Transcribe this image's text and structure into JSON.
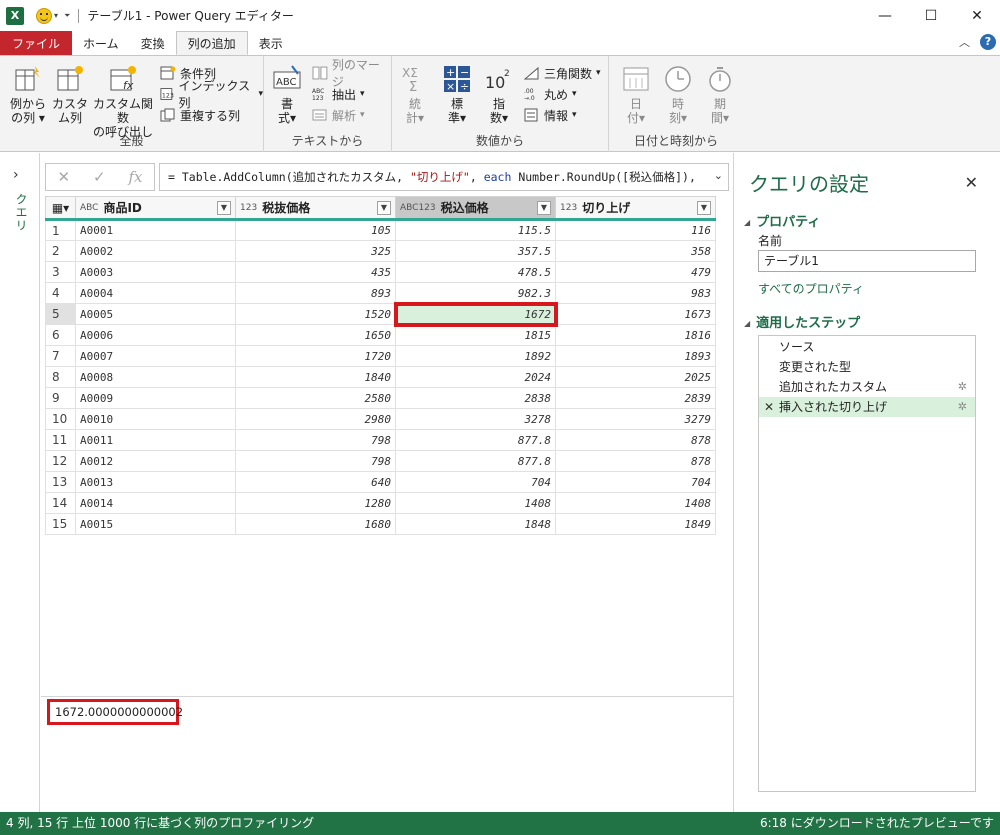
{
  "titlebar": {
    "app_icon": "X",
    "title": "テーブル1 - Power Query エディター",
    "minimize_icon": "—",
    "maximize_icon": "☐",
    "close_icon": "✕"
  },
  "menu": {
    "tabs": [
      "ファイル",
      "ホーム",
      "変換",
      "列の追加",
      "表示"
    ],
    "active": "列の追加"
  },
  "ribbon": {
    "general": {
      "label": "全般",
      "example_col": [
        "例から",
        "の列"
      ],
      "custom_col": [
        "カスタ",
        "ム列"
      ],
      "custom_func": [
        "カスタム関数",
        "の呼び出し"
      ],
      "conditional": "条件列",
      "index": "インデックス列",
      "duplicate": "重複する列"
    },
    "text": {
      "label": "テキストから",
      "format": [
        "書",
        "式"
      ],
      "merge": "列のマージ",
      "extract": "抽出",
      "parse": "解析"
    },
    "number": {
      "label": "数値から",
      "stats": [
        "統",
        "計"
      ],
      "standard": [
        "標",
        "準"
      ],
      "scientific": [
        "指",
        "数"
      ],
      "trig": "三角関数",
      "round": "丸め",
      "info": "情報"
    },
    "datetime": {
      "label": "日付と時刻から",
      "date": [
        "日",
        "付"
      ],
      "time": [
        "時",
        "刻"
      ],
      "duration": [
        "期",
        "間"
      ]
    }
  },
  "leftpane": {
    "label": "クエリ"
  },
  "formula": {
    "prefix": "= Table.AddColumn(追加されたカスタム, ",
    "str": "\"切り上げ\"",
    "mid": ", ",
    "kw": "each",
    "suffix": " Number.RoundUp([税込価格]),"
  },
  "table": {
    "headers": [
      {
        "type": "ABC",
        "name": "商品ID"
      },
      {
        "type": "123",
        "name": "税抜価格"
      },
      {
        "type": "ABC123",
        "name": "税込価格"
      },
      {
        "type": "123",
        "name": "切り上げ"
      }
    ],
    "rows": [
      [
        "1",
        "A0001",
        "105",
        "115.5",
        "116"
      ],
      [
        "2",
        "A0002",
        "325",
        "357.5",
        "358"
      ],
      [
        "3",
        "A0003",
        "435",
        "478.5",
        "479"
      ],
      [
        "4",
        "A0004",
        "893",
        "982.3",
        "983"
      ],
      [
        "5",
        "A0005",
        "1520",
        "1672",
        "1673"
      ],
      [
        "6",
        "A0006",
        "1650",
        "1815",
        "1816"
      ],
      [
        "7",
        "A0007",
        "1720",
        "1892",
        "1893"
      ],
      [
        "8",
        "A0008",
        "1840",
        "2024",
        "2025"
      ],
      [
        "9",
        "A0009",
        "2580",
        "2838",
        "2839"
      ],
      [
        "10",
        "A0010",
        "2980",
        "3278",
        "3279"
      ],
      [
        "11",
        "A0011",
        "798",
        "877.8",
        "878"
      ],
      [
        "12",
        "A0012",
        "798",
        "877.8",
        "878"
      ],
      [
        "13",
        "A0013",
        "640",
        "704",
        "704"
      ],
      [
        "14",
        "A0014",
        "1280",
        "1408",
        "1408"
      ],
      [
        "15",
        "A0015",
        "1680",
        "1848",
        "1849"
      ]
    ]
  },
  "preview": {
    "value": "1672.0000000000002"
  },
  "settings": {
    "title": "クエリの設定",
    "properties": "プロパティ",
    "name_label": "名前",
    "name_value": "テーブル1",
    "all_props": "すべてのプロパティ",
    "applied": "適用したステップ",
    "steps": [
      "ソース",
      "変更された型",
      "追加されたカスタム",
      "挿入された切り上げ"
    ]
  },
  "status": {
    "counts": "4 列, 15 行",
    "profiling": "上位 1000 行に基づく列のプロファイリング",
    "download": "6:18 にダウンロードされたプレビューです"
  },
  "colors": {
    "accent_green": "#217346",
    "highlight_red": "#d6181e",
    "file_tab": "#c4262e",
    "header_underline": "#33a593"
  }
}
